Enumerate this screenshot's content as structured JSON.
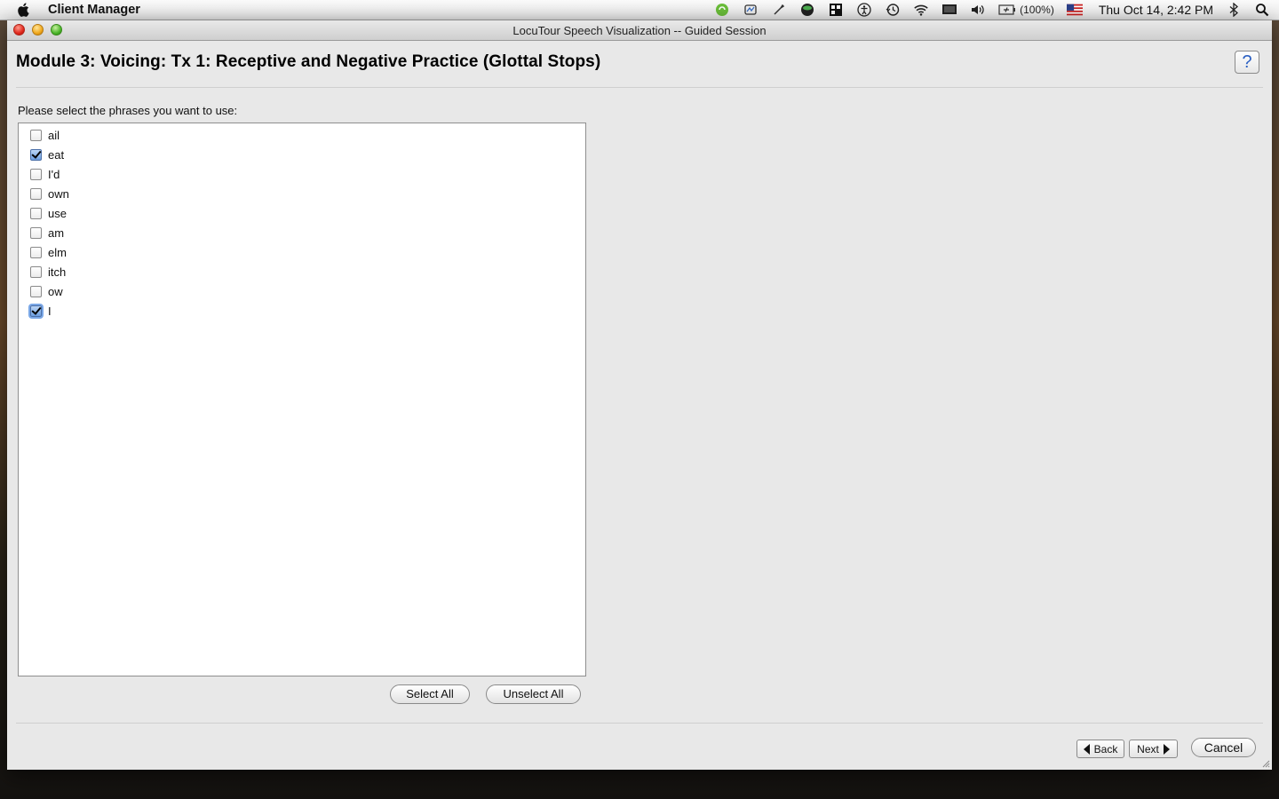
{
  "menubar": {
    "app_name": "Client Manager",
    "battery": "(100%)",
    "clock": "Thu Oct 14,  2:42 PM"
  },
  "window": {
    "title": "LocuTour Speech Visualization -- Guided Session",
    "module_title": "Module 3: Voicing: Tx 1: Receptive and Negative Practice (Glottal Stops)",
    "help_label": "?",
    "prompt": "Please select the phrases you want to use:",
    "phrases": [
      {
        "label": "ail",
        "checked": false
      },
      {
        "label": "eat",
        "checked": true
      },
      {
        "label": "I'd",
        "checked": false
      },
      {
        "label": "own",
        "checked": false
      },
      {
        "label": "use",
        "checked": false
      },
      {
        "label": "am",
        "checked": false
      },
      {
        "label": "elm",
        "checked": false
      },
      {
        "label": "itch",
        "checked": false
      },
      {
        "label": "ow",
        "checked": false
      },
      {
        "label": "I",
        "checked": true
      }
    ],
    "select_all_label": "Select All",
    "unselect_all_label": "Unselect All",
    "back_label": "Back",
    "next_label": "Next",
    "cancel_label": "Cancel"
  }
}
